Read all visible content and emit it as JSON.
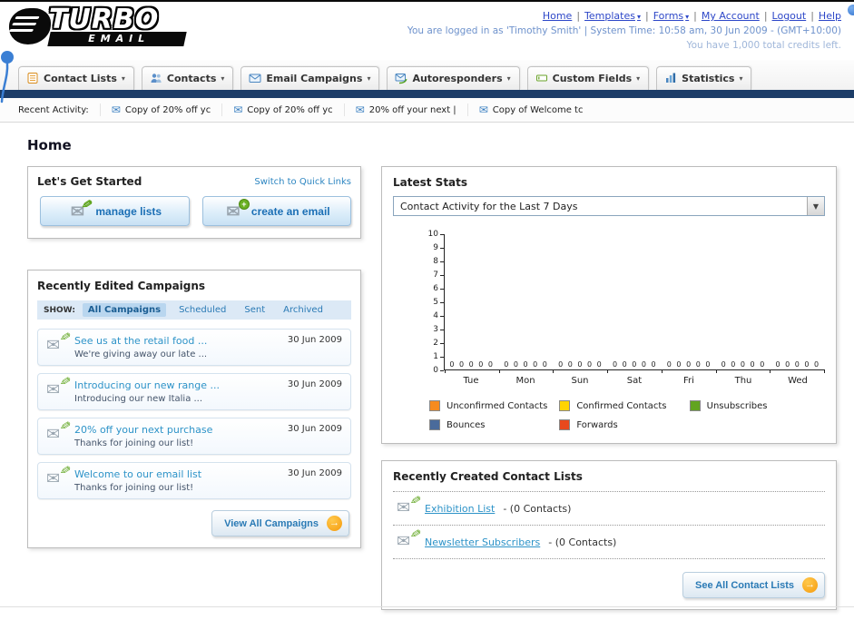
{
  "icons": {
    "dropdown_arrow": "▾",
    "select_arrow": "▼",
    "envelope": "✉",
    "pencil": "✎",
    "plus": "+",
    "arrow_right": "→"
  },
  "header": {
    "logo_line1": "TURBO",
    "logo_line2": "EMAIL",
    "links": [
      {
        "label": "Home"
      },
      {
        "label": "Templates"
      },
      {
        "label": "Forms"
      },
      {
        "label": "My Account"
      },
      {
        "label": "Logout"
      },
      {
        "label": "Help"
      }
    ],
    "login_info": "You are logged in as 'Timothy Smith' | System Time: 10:58 am, 30 Jun 2009 - (GMT+10:00)",
    "credits_info": "You have 1,000 total credits left."
  },
  "nav": {
    "tabs": [
      {
        "label": "Contact Lists"
      },
      {
        "label": "Contacts"
      },
      {
        "label": "Email Campaigns"
      },
      {
        "label": "Autoresponders"
      },
      {
        "label": "Custom Fields"
      },
      {
        "label": "Statistics"
      }
    ]
  },
  "recent_activity": {
    "label": "Recent Activity:",
    "items": [
      {
        "text": "Copy of 20% off yc"
      },
      {
        "text": "Copy of 20% off yc"
      },
      {
        "text": "20% off your next |"
      },
      {
        "text": "Copy of Welcome tc"
      }
    ]
  },
  "page": {
    "title": "Home"
  },
  "get_started": {
    "title": "Let's Get Started",
    "switch_link": "Switch to Quick Links",
    "manage_lists_button": "manage lists",
    "create_email_button": "create an email"
  },
  "campaigns": {
    "title": "Recently Edited Campaigns",
    "show_label": "SHOW:",
    "tabs": [
      {
        "label": "All Campaigns"
      },
      {
        "label": "Scheduled"
      },
      {
        "label": "Sent"
      },
      {
        "label": "Archived"
      }
    ],
    "active_tab": "All Campaigns",
    "items": [
      {
        "title": "See us at the retail food ...",
        "subtitle": "We're giving away our late ...",
        "date": "30 Jun 2009"
      },
      {
        "title": "Introducing our new range ...",
        "subtitle": "Introducing our new Italia ...",
        "date": "30 Jun 2009"
      },
      {
        "title": "20% off your next purchase",
        "subtitle": "Thanks for joining our list!",
        "date": "30 Jun 2009"
      },
      {
        "title": "Welcome to our email list",
        "subtitle": "Thanks for joining our list!",
        "date": "30 Jun 2009"
      }
    ],
    "view_all_button": "View All Campaigns"
  },
  "stats": {
    "title": "Latest Stats",
    "period_selector": "Contact Activity for the Last 7 Days",
    "chart_data": {
      "type": "bar",
      "title": "Contact Activity for the Last 7 Days",
      "categories": [
        "Tue",
        "Mon",
        "Sun",
        "Sat",
        "Fri",
        "Thu",
        "Wed"
      ],
      "series": [
        {
          "name": "Unconfirmed Contacts",
          "color": "#f68b1f",
          "values": [
            0,
            0,
            0,
            0,
            0,
            0,
            0
          ]
        },
        {
          "name": "Confirmed Contacts",
          "color": "#ffd400",
          "values": [
            0,
            0,
            0,
            0,
            0,
            0,
            0
          ]
        },
        {
          "name": "Unsubscribes",
          "color": "#62a420",
          "values": [
            0,
            0,
            0,
            0,
            0,
            0,
            0
          ]
        },
        {
          "name": "Bounces",
          "color": "#4a6b9b",
          "values": [
            0,
            0,
            0,
            0,
            0,
            0,
            0
          ]
        },
        {
          "name": "Forwards",
          "color": "#e8491d",
          "values": [
            0,
            0,
            0,
            0,
            0,
            0,
            0
          ]
        }
      ],
      "ylim": [
        0,
        10
      ],
      "grid": false,
      "legend_position": "bottom"
    }
  },
  "contact_lists": {
    "title": "Recently Created Contact Lists",
    "items": [
      {
        "name": "Exhibition List",
        "detail": "- (0 Contacts)"
      },
      {
        "name": "Newsletter Subscribers",
        "detail": "- (0 Contacts)"
      }
    ],
    "see_all_button": "See All Contact Lists"
  }
}
